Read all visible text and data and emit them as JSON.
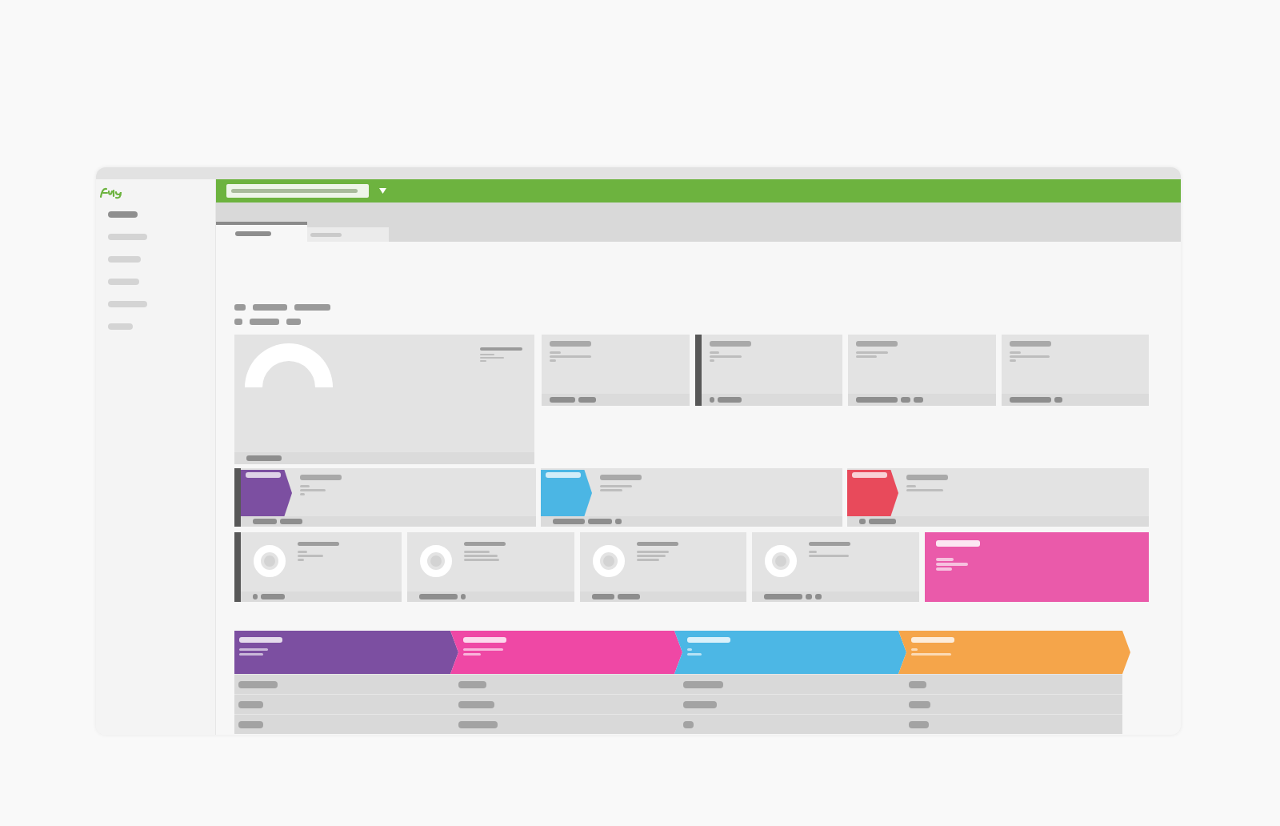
{
  "sidebar": {
    "items": [
      {
        "selected": true
      },
      {
        "selected": false
      },
      {
        "selected": false
      },
      {
        "selected": false
      },
      {
        "selected": false
      },
      {
        "selected": false
      }
    ]
  },
  "tabs": [
    {
      "selected": true
    },
    {
      "selected": false
    }
  ],
  "stat_cards": [
    {
      "kind": "gauge",
      "highlighted": false
    },
    {
      "kind": "stat",
      "highlighted": false
    },
    {
      "kind": "stat",
      "highlighted": true
    },
    {
      "kind": "stat",
      "highlighted": false
    },
    {
      "kind": "stat",
      "highlighted": false
    }
  ],
  "badge_cards": [
    {
      "color": "#7c4fa1",
      "highlighted": true
    },
    {
      "color": "#4bb6e4",
      "highlighted": false
    },
    {
      "color": "#e84a5b",
      "highlighted": false
    }
  ],
  "ring_cards": [
    {
      "kind": "ring",
      "highlighted": true
    },
    {
      "kind": "ring",
      "highlighted": false
    },
    {
      "kind": "ring",
      "highlighted": false
    },
    {
      "kind": "ring",
      "highlighted": false
    },
    {
      "kind": "feature",
      "color": "#ea5aaa"
    }
  ],
  "pipeline": {
    "stages": [
      {
        "color": "#7c4fa1"
      },
      {
        "color": "#ef48a5"
      },
      {
        "color": "#4cb7e5"
      },
      {
        "color": "#f5a54a"
      }
    ]
  }
}
